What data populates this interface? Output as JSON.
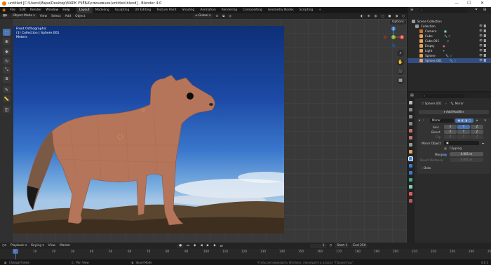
{
  "window": {
    "title": "untitled [C:\\Users\\Мари\\Desktop\\МАРК УЧЁБА\\слюнявчик\\untitled.blend] - Blender 4.0",
    "minimize": "—",
    "maximize": "☐",
    "close": "✕"
  },
  "menu": [
    "File",
    "Edit",
    "Render",
    "Window",
    "Help"
  ],
  "workspaces": [
    "Layout",
    "Modeling",
    "Sculpting",
    "UV Editing",
    "Texture Paint",
    "Shading",
    "Animation",
    "Rendering",
    "Compositing",
    "Geometry Nodes",
    "Scripting"
  ],
  "scene_field": "Scene",
  "viewlayer_field": "ViewLayer",
  "viewport_header": {
    "mode": "Object Mode",
    "menus": [
      "View",
      "Select",
      "Add",
      "Object"
    ],
    "orientation": "Global",
    "options": "Options"
  },
  "viewport_info": {
    "view": "Front Orthographic",
    "collection": "(1) Collection | Sphere.001",
    "units": "Meters"
  },
  "gizmo": {
    "z": "Z",
    "y": "Y",
    "x": "X"
  },
  "outliner": {
    "root": "Scene Collection",
    "items": [
      {
        "label": "Collection",
        "color": "#9a9a9a"
      },
      {
        "label": "Camera",
        "color": "#c9752e"
      },
      {
        "label": "Cube",
        "color": "#e6a35b"
      },
      {
        "label": "Cube.001",
        "color": "#e6a35b"
      },
      {
        "label": "Empty",
        "color": "#e6a35b"
      },
      {
        "label": "Light",
        "color": "#e6a35b"
      },
      {
        "label": "Sphere",
        "color": "#e6a35b"
      },
      {
        "label": "Sphere.001",
        "color": "#e6a35b"
      }
    ]
  },
  "properties": {
    "object": "Sphere.001",
    "tab": "Mirror",
    "add_modifier": "Add Modifier",
    "modifier_name": "Mirror",
    "axis_label": "Axis",
    "bisect_label": "Bisect",
    "flip_label": "Flip",
    "x": "X",
    "y": "Y",
    "z": "Z",
    "mirror_object": "Mirror Object",
    "clipping": "Clipping",
    "merge": "Merge",
    "merge_value": "0.001 m",
    "bisect_distance": "Bisect Distance",
    "bisect_distance_value": "0.001 m",
    "data": "Data"
  },
  "timeline": {
    "menus": [
      "Playback",
      "Keying",
      "View",
      "Marker"
    ],
    "current_frame": "1",
    "start_label": "Start",
    "start": "1",
    "end_label": "End",
    "end": "250",
    "ticks": [
      "0",
      "10",
      "20",
      "30",
      "40",
      "50",
      "60",
      "70",
      "80",
      "90",
      "100",
      "110",
      "120",
      "130",
      "140",
      "150",
      "160",
      "170",
      "180",
      "190",
      "200",
      "210",
      "220",
      "230",
      "240",
      "250"
    ]
  },
  "status": {
    "left": "Change Frame",
    "middle": "Pan View",
    "right": "Sbuel Mode",
    "activation": "Чтобы активировать Windows, перейдите в раздел \"Параметры\".",
    "version": "4.0.2"
  }
}
